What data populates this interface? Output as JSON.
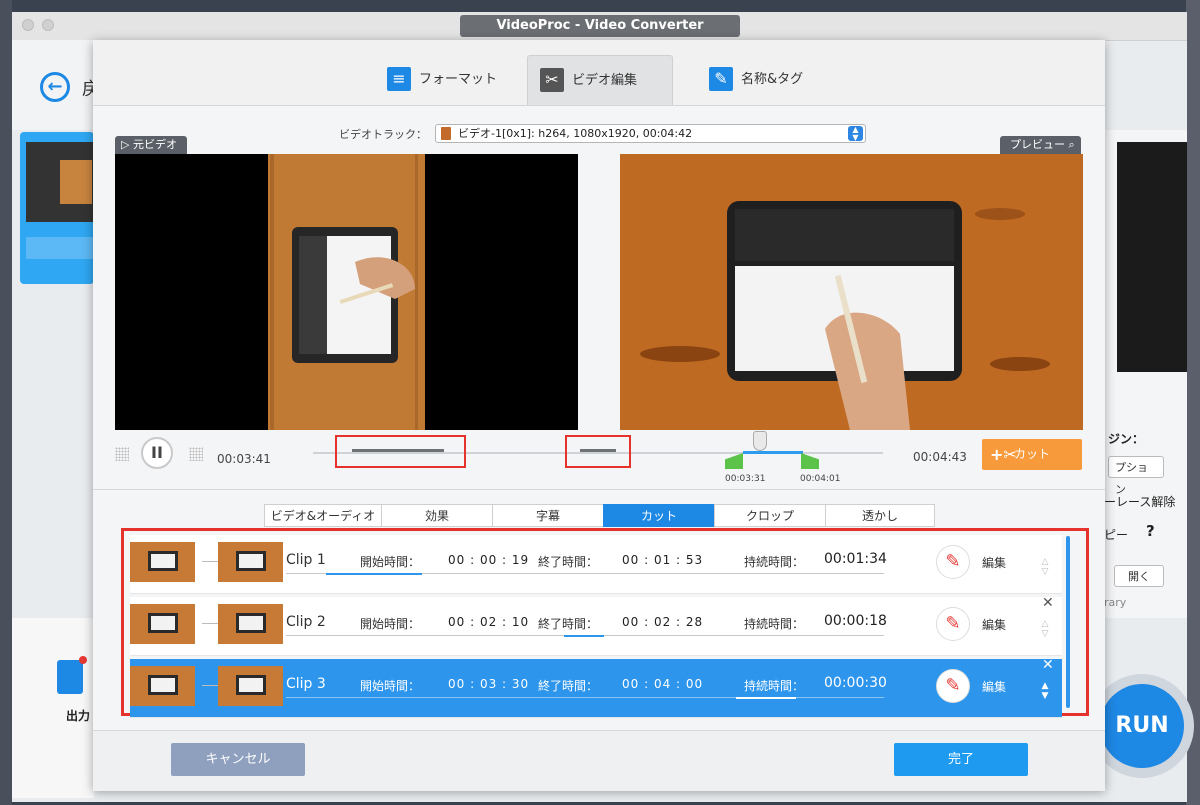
{
  "window": {
    "title": "VideoProc - Video Converter"
  },
  "background_app": {
    "back_label": "戻",
    "output_label": "出力",
    "right_panel": {
      "engine_label": "ジン：",
      "option_button": "プション",
      "deinterlace": "ーレース解除",
      "copy_label": "ピー",
      "help_icon": "?",
      "open_button": "開く",
      "library_text": "rary"
    },
    "run_button": "RUN"
  },
  "dialog": {
    "tabs": [
      {
        "label": "フォーマット",
        "icon": "format-icon"
      },
      {
        "label": "ビデオ編集",
        "icon": "video-edit-icon"
      },
      {
        "label": "名称&タグ",
        "icon": "name-tag-icon"
      }
    ],
    "active_tab": 1,
    "video_track": {
      "label": "ビデオトラック：",
      "value": "ビデオ-1[0x1]: h264, 1080x1920, 00:04:42"
    },
    "source_label": "元ビデオ",
    "preview_label": "プレビュー",
    "player": {
      "current_time": "00:03:41",
      "end_time": "00:04:43",
      "range_start": "00:03:31",
      "range_end": "00:04:01",
      "cut_button": "カット"
    },
    "subtabs": [
      "ビデオ&オーディオ",
      "効果",
      "字幕",
      "カット",
      "クロップ",
      "透かし"
    ],
    "active_subtab": 3,
    "labels": {
      "start": "開始時間：",
      "end": "終了時間：",
      "duration": "持続時間：",
      "edit": "編集"
    },
    "clips": [
      {
        "name": "Clip 1",
        "start": "00 : 00 : 19",
        "end": "00 : 01 : 53",
        "duration": "00:01:34",
        "selected": false
      },
      {
        "name": "Clip 2",
        "start": "00 : 02 : 10",
        "end": "00 : 02 : 28",
        "duration": "00:00:18",
        "selected": false
      },
      {
        "name": "Clip 3",
        "start": "00 : 03 : 30",
        "end": "00 : 04 : 00",
        "duration": "00:00:30",
        "selected": true
      }
    ],
    "cancel_button": "キャンセル",
    "done_button": "完了"
  },
  "colors": {
    "accent": "#1e88e5",
    "cut_button": "#f79a3b",
    "highlight_box": "#e5322d",
    "range_flag": "#5cc34a",
    "cancel_button": "#8fa0bf"
  }
}
